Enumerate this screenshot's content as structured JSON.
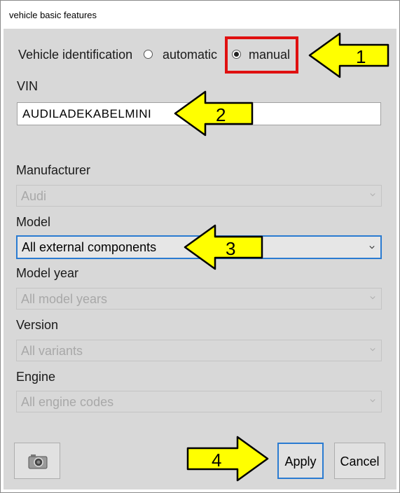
{
  "window": {
    "title": "vehicle basic features"
  },
  "identification": {
    "label": "Vehicle identification",
    "options": [
      {
        "label": "automatic",
        "selected": false
      },
      {
        "label": "manual",
        "selected": true
      }
    ]
  },
  "vin": {
    "label": "VIN",
    "value": "AUDILADEKABELMINI"
  },
  "fields": {
    "manufacturer": {
      "label": "Manufacturer",
      "value": "Audi"
    },
    "model": {
      "label": "Model",
      "value": "All external components"
    },
    "model_year": {
      "label": "Model year",
      "value": "All model years"
    },
    "version": {
      "label": "Version",
      "value": "All variants"
    },
    "engine": {
      "label": "Engine",
      "value": "All engine codes"
    }
  },
  "callouts": [
    "1",
    "2",
    "3",
    "4"
  ],
  "buttons": {
    "apply": "Apply",
    "cancel": "Cancel",
    "snapshot_icon": "camera-icon"
  },
  "colors": {
    "highlight": "#e01010",
    "callout_fill": "#ffff00",
    "focus": "#2a7bd1"
  }
}
